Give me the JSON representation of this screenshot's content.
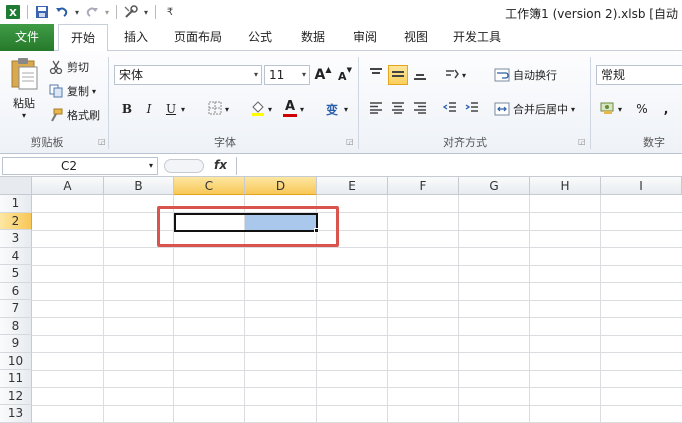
{
  "window": {
    "title": "工作簿1 (version 2).xlsb [自动"
  },
  "qat": {
    "app_icon": "excel-icon",
    "save_icon": "save-icon",
    "undo_icon": "undo-icon",
    "redo_icon": "redo-icon",
    "tools_icon": "tools-icon"
  },
  "tabs": [
    {
      "label": "文件"
    },
    {
      "label": "开始"
    },
    {
      "label": "插入"
    },
    {
      "label": "页面布局"
    },
    {
      "label": "公式"
    },
    {
      "label": "数据"
    },
    {
      "label": "审阅"
    },
    {
      "label": "视图"
    },
    {
      "label": "开发工具"
    }
  ],
  "clipboard": {
    "paste": "粘贴",
    "cut": "剪切",
    "copy": "复制",
    "format_painter": "格式刷",
    "label": "剪贴板"
  },
  "font": {
    "name": "宋体",
    "size": "11",
    "grow": "A",
    "shrink": "A",
    "bold": "B",
    "italic": "I",
    "underline": "U",
    "label": "字体",
    "phonetic": "变"
  },
  "alignment": {
    "wrap_text": "自动换行",
    "merge_center": "合并后居中",
    "label": "对齐方式"
  },
  "number": {
    "format": "常规",
    "percent": "%",
    "comma": ",",
    "label": "数字"
  },
  "formula_bar": {
    "name_box": "C2",
    "fx": "fx",
    "content": ""
  },
  "grid": {
    "columns": [
      "A",
      "B",
      "C",
      "D",
      "E",
      "F",
      "G",
      "H",
      "I"
    ],
    "rows": [
      "1",
      "2",
      "3",
      "4",
      "5",
      "6",
      "7",
      "8",
      "9",
      "10",
      "11",
      "12",
      "13"
    ],
    "active_cell": "C2",
    "selected_range": "C2:D2"
  },
  "colors": {
    "file_tab": "#2e7d32",
    "selection_fill": "#a9c8ec",
    "active_header": "#f8c757",
    "annotation": "#d9534f"
  }
}
